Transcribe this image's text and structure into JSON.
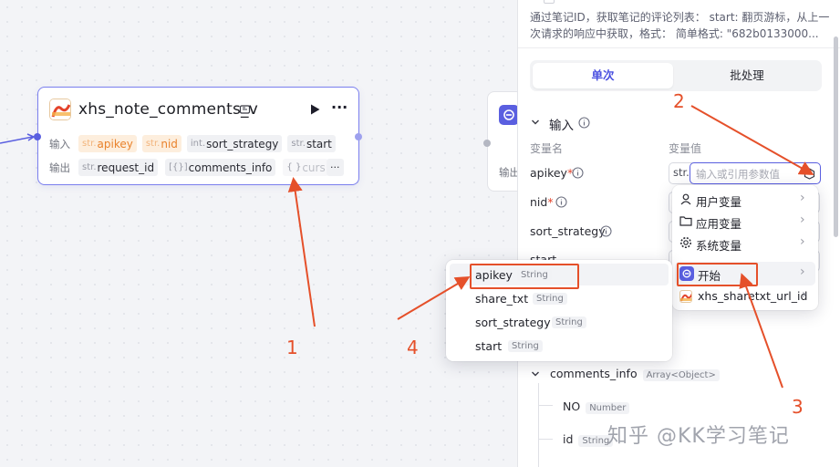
{
  "node": {
    "title": "xhs_note_comments_v",
    "input_label": "输入",
    "output_label": "输出",
    "inputs": [
      {
        "type": "str.",
        "name": "apikey"
      },
      {
        "type": "str.",
        "name": "nid"
      },
      {
        "type": "int.",
        "name": "sort_strategy"
      },
      {
        "type": "str.",
        "name": "start"
      }
    ],
    "outputs": [
      {
        "type": "str.",
        "name": "request_id"
      },
      {
        "type": "[{}]",
        "name": "comments_info"
      },
      {
        "type": "{ }",
        "name": "curs"
      }
    ],
    "more": "···",
    "output_label_2": "输出"
  },
  "panel": {
    "description": "通过笔记ID，获取笔记的评论列表： start: 翻页游标，从上一次请求的响应中获取，格式： 简单格式: \"682b0133000...",
    "tabs": [
      "单次",
      "批处理"
    ],
    "input_section": "输入",
    "col_name": "变量名",
    "col_value": "变量值",
    "vars": [
      "apikey",
      "nid",
      "sort_strategy",
      "start"
    ],
    "required_mark": "*",
    "value_type": "str.",
    "placeholder": "输入或引用参数值",
    "output_tree": [
      {
        "name": "comments_info",
        "type": "Array<Object>"
      },
      {
        "name": "NO",
        "type": "Number"
      },
      {
        "name": "id",
        "type": "String"
      }
    ]
  },
  "source_menu": [
    {
      "label": "用户变量",
      "icon": "user-icon"
    },
    {
      "label": "应用变量",
      "icon": "folder-icon"
    },
    {
      "label": "系统变量",
      "icon": "gear-icon"
    },
    {
      "label": "开始",
      "icon": "start-icon"
    },
    {
      "label": "xhs_sharetxt_url_id",
      "icon": "node-logo-icon"
    }
  ],
  "param_menu": [
    {
      "name": "apikey",
      "type": "String"
    },
    {
      "name": "share_txt",
      "type": "String"
    },
    {
      "name": "sort_strategy",
      "type": "String"
    },
    {
      "name": "start",
      "type": "String"
    }
  ],
  "annotations": [
    "1",
    "2",
    "3",
    "4"
  ],
  "watermark": "知乎 @KK学习笔记",
  "colors": {
    "accent": "#4a50e0",
    "annotation": "#e5502a",
    "node_border": "#7b7fee"
  }
}
